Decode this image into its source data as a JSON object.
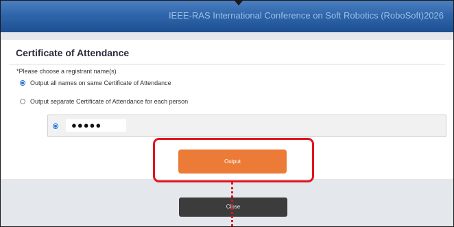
{
  "header": {
    "title": "IEEE-RAS International Conference on Soft Robotics (RoboSoft)2026"
  },
  "dialog": {
    "title": "Certificate of Attendance",
    "prompt": "*Please choose a registrant name(s)",
    "options": [
      {
        "label": "Output all names on same Certificate of Attendance",
        "checked": true
      },
      {
        "label": "Output separate Certificate of Attendance for each person",
        "checked": false
      }
    ],
    "registrant": {
      "name_masked": "●●●●●",
      "checked": true
    },
    "output_label": "Output",
    "close_label": "Close"
  },
  "colors": {
    "header": "#2f66ab",
    "output_button": "#ec7b37",
    "close_button": "#3c3c3c",
    "annotation": "#e0141c",
    "radio_selected": "#1f73d6"
  }
}
